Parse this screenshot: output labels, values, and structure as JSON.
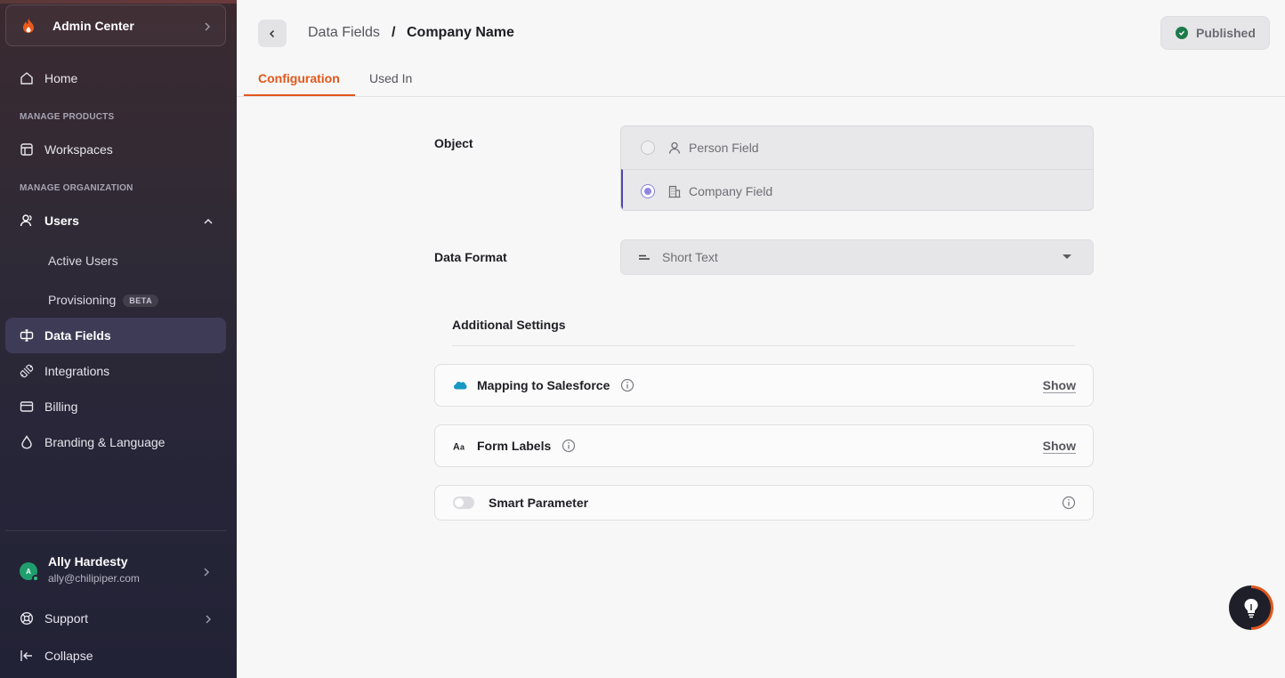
{
  "sidebar": {
    "app_name": "Admin Center",
    "home": "Home",
    "section_products": "MANAGE PRODUCTS",
    "workspaces": "Workspaces",
    "section_org": "MANAGE ORGANIZATION",
    "users": "Users",
    "active_users": "Active Users",
    "provisioning": "Provisioning",
    "beta_badge": "BETA",
    "data_fields": "Data Fields",
    "integrations": "Integrations",
    "billing": "Billing",
    "branding": "Branding & Language",
    "user": {
      "initial": "A",
      "name": "Ally Hardesty",
      "email": "ally@chilipiper.com"
    },
    "support": "Support",
    "collapse": "Collapse"
  },
  "header": {
    "breadcrumb_parent": "Data Fields",
    "breadcrumb_sep": "/",
    "breadcrumb_current": "Company Name",
    "status": "Published",
    "tabs": [
      {
        "label": "Configuration",
        "active": true
      },
      {
        "label": "Used In",
        "active": false
      }
    ]
  },
  "form": {
    "object_label": "Object",
    "object_options": [
      {
        "label": "Person Field",
        "selected": false,
        "icon": "person-icon"
      },
      {
        "label": "Company Field",
        "selected": true,
        "icon": "building-icon"
      }
    ],
    "data_format_label": "Data Format",
    "data_format_value": "Short Text",
    "additional_settings_title": "Additional Settings",
    "settings": [
      {
        "label": "Mapping to Salesforce",
        "action": "Show",
        "icon": "salesforce-icon"
      },
      {
        "label": "Form Labels",
        "action": "Show",
        "icon": "text-format-icon"
      },
      {
        "label": "Smart Parameter",
        "toggle": false
      }
    ]
  },
  "colors": {
    "accent": "#e2571b",
    "selected_radio": "#8e86e0",
    "published": "#1e7a4c"
  }
}
